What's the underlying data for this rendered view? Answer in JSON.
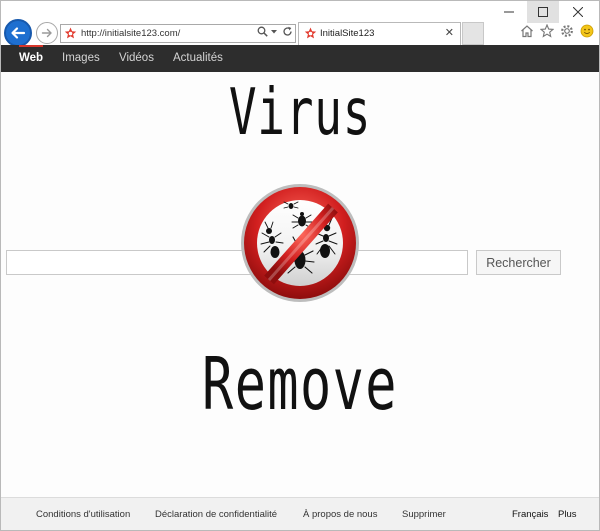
{
  "browser": {
    "url": "http://initialsite123.com/",
    "tab_title": "InitialSite123",
    "icons": {
      "back": "back-arrow-icon",
      "forward": "forward-arrow-icon",
      "search": "search-icon",
      "dropdown": "chevron-down-icon",
      "refresh": "refresh-icon",
      "tab_close": "close-icon",
      "home": "home-icon",
      "favorites": "star-icon",
      "settings": "gear-icon",
      "feedback": "smiley-icon"
    }
  },
  "nav": {
    "items": [
      {
        "label": "Web",
        "active": true
      },
      {
        "label": "Images",
        "active": false
      },
      {
        "label": "Vidéos",
        "active": false
      },
      {
        "label": "Actualités",
        "active": false
      }
    ]
  },
  "main": {
    "title_top": "Virus",
    "title_bottom": "Remove",
    "search_value": "",
    "search_button": "Rechercher"
  },
  "footer": {
    "links": [
      "Conditions d'utilisation",
      "Déclaration de confidentialité",
      "À propos de nous",
      "Supprimer"
    ],
    "language": "Français",
    "more": "Plus"
  },
  "colors": {
    "accent_blue": "#1e6fd0",
    "nav_bg": "#2d2d2d",
    "nav_active_bar": "#d6362b",
    "logo_red": "#d11f1f"
  }
}
